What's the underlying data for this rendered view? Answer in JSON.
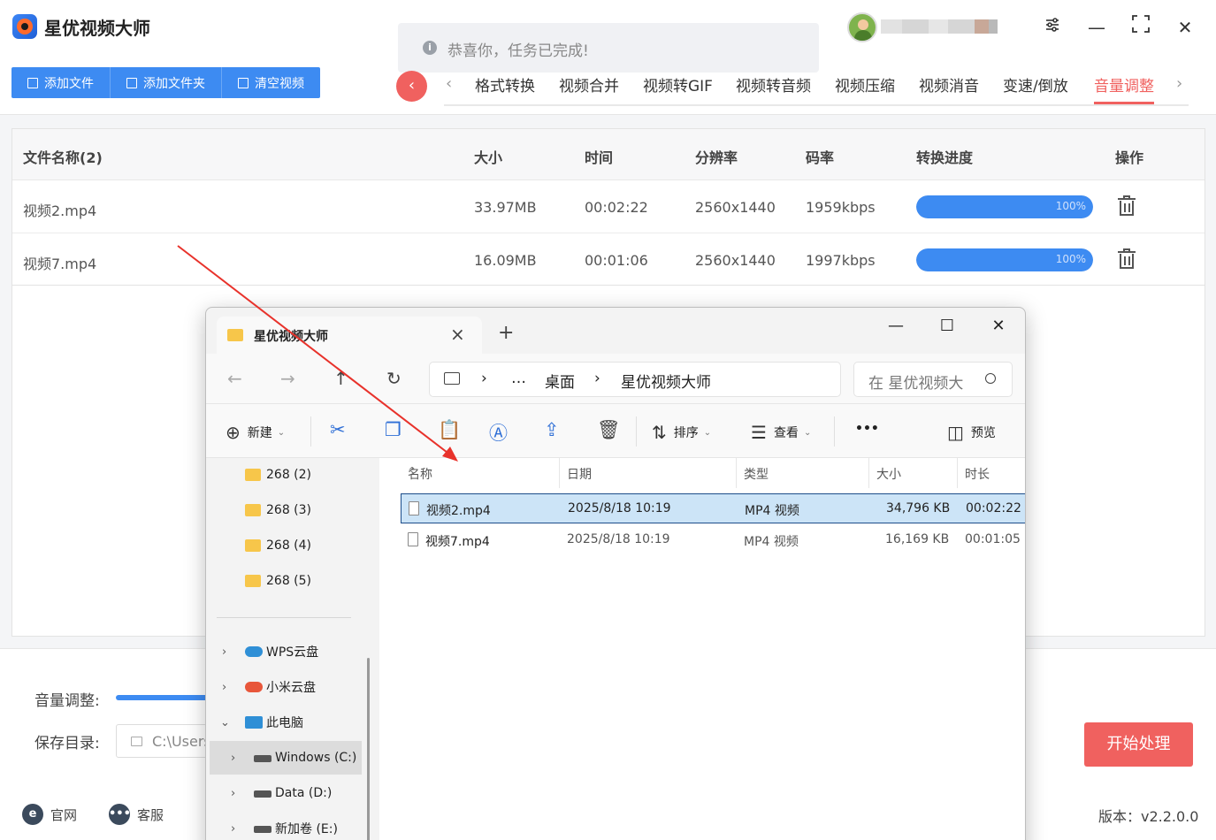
{
  "app": {
    "title": "星优视频大师",
    "toast": "恭喜你，任务已完成!",
    "buttons": {
      "add_file": "添加文件",
      "add_folder": "添加文件夹",
      "clear": "清空视频"
    },
    "tabs": [
      {
        "label": "格式转换"
      },
      {
        "label": "视频合并"
      },
      {
        "label": "视频转GIF"
      },
      {
        "label": "视频转音频"
      },
      {
        "label": "视频压缩"
      },
      {
        "label": "视频消音"
      },
      {
        "label": "变速/倒放"
      },
      {
        "label": "音量调整"
      }
    ],
    "active_tab": "音量调整",
    "accent_color": "#f0615f",
    "primary_color": "#3d8bf2"
  },
  "table": {
    "headers": {
      "name": "文件名称(2)",
      "size": "大小",
      "time": "时间",
      "resolution": "分辨率",
      "bitrate": "码率",
      "progress": "转换进度",
      "action": "操作"
    },
    "rows": [
      {
        "name": "视频2.mp4",
        "size": "33.97MB",
        "time": "00:02:22",
        "resolution": "2560x1440",
        "bitrate": "1959kbps",
        "progress_label": "100%",
        "progress": 100
      },
      {
        "name": "视频7.mp4",
        "size": "16.09MB",
        "time": "00:01:06",
        "resolution": "2560x1440",
        "bitrate": "1997kbps",
        "progress_label": "100%",
        "progress": 100
      }
    ]
  },
  "bottom": {
    "volume_label": "音量调整:",
    "save_label": "保存目录:",
    "save_path": "C:\\Users",
    "start_button": "开始处理",
    "official_site": "官网",
    "support": "客服",
    "version": "版本：v2.2.0.0"
  },
  "explorer": {
    "tab_title": "星优视频大师",
    "breadcrumb": [
      "…",
      "桌面",
      "星优视频大师"
    ],
    "search_placeholder": "在 星优视频大",
    "commands": {
      "new": "新建",
      "sort": "排序",
      "view": "查看",
      "more": "•••",
      "preview": "预览"
    },
    "sidebar": {
      "folders": [
        "268 (2)",
        "268 (3)",
        "268 (4)",
        "268 (5)"
      ],
      "wps": "WPS云盘",
      "xiaomi": "小米云盘",
      "this_pc": "此电脑",
      "drives": [
        "Windows (C:)",
        "Data (D:)",
        "新加卷 (E:)"
      ]
    },
    "columns": {
      "name": "名称",
      "date": "日期",
      "type": "类型",
      "size": "大小",
      "duration": "时长"
    },
    "files": [
      {
        "name": "视频2.mp4",
        "date": "2025/8/18 10:19",
        "type": "MP4 视频",
        "size": "34,796 KB",
        "duration": "00:02:22"
      },
      {
        "name": "视频7.mp4",
        "date": "2025/8/18 10:19",
        "type": "MP4 视频",
        "size": "16,169 KB",
        "duration": "00:01:05"
      }
    ]
  },
  "icons": {
    "settings": "sliders-icon",
    "minimize": "minimize-icon",
    "maximize": "maximize-icon",
    "close": "close-icon"
  }
}
